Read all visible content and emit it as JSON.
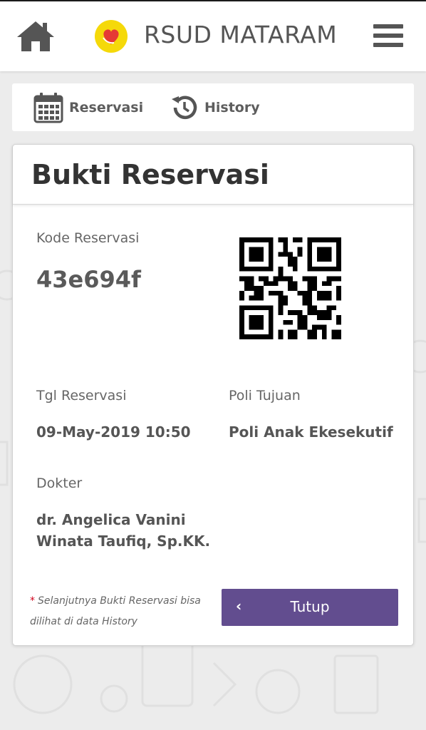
{
  "header": {
    "brand": "RSUD MATARAM",
    "home_icon": "home-icon",
    "menu_icon": "hamburger-menu-icon",
    "logo_icon": "heart-hands-logo"
  },
  "tabs": [
    {
      "label": "Reservasi",
      "icon": "calendar-icon"
    },
    {
      "label": "History",
      "icon": "history-icon"
    }
  ],
  "card": {
    "title": "Bukti Reservasi",
    "kode_label": "Kode Reservasi",
    "kode_value": "43e694f",
    "tgl_label": "Tgl Reservasi",
    "tgl_value": "09-May-2019 10:50",
    "poli_label": "Poli Tujuan",
    "poli_value": "Poli Anak Ekesekutif",
    "dokter_label": "Dokter",
    "dokter_line1": "dr. Angelica Vanini",
    "dokter_line2": "Winata Taufiq, Sp.KK.",
    "note_star": "*",
    "note_line1": "Selanjutnya Bukti Reservasi bisa",
    "note_line2": "dilihat di data History",
    "close_icon": "chevron-left-icon",
    "close_label": "Tutup"
  },
  "colors": {
    "accent": "#624d8f",
    "required_star": "#d0021b",
    "logo_bg": "#f5d90a",
    "logo_heart": "#e53935"
  }
}
